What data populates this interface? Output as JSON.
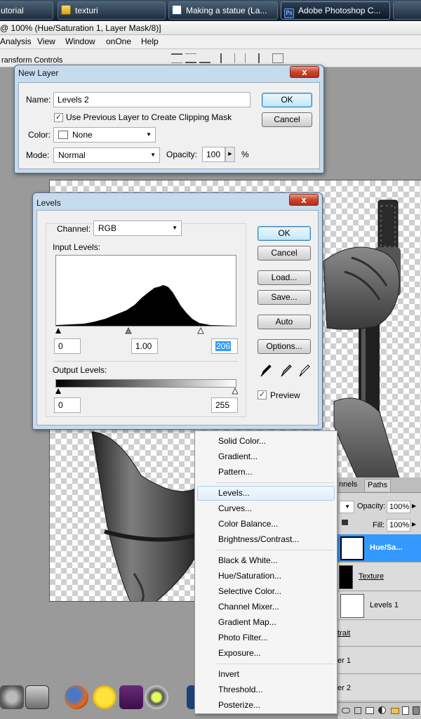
{
  "taskbar": {
    "tasks": [
      {
        "label": "utorial"
      },
      {
        "label": "texturi"
      },
      {
        "label": "Making a statue (La..."
      },
      {
        "label": "Adobe Photoshop C..."
      }
    ]
  },
  "photoshop": {
    "title": "@ 100% (Hue/Saturation 1, Layer Mask/8)]",
    "menu": [
      "Analysis",
      "View",
      "Window",
      "onOne",
      "Help"
    ],
    "options_label": "ransform Controls"
  },
  "new_layer_dialog": {
    "title": "New Layer",
    "close": "x",
    "name_label": "Name:",
    "name_value": "Levels 2",
    "clip_label": "Use Previous Layer to Create Clipping Mask",
    "clip_checked": true,
    "color_label": "Color:",
    "color_value": "None",
    "mode_label": "Mode:",
    "mode_value": "Normal",
    "opacity_label": "Opacity:",
    "opacity_value": "100",
    "percent": "%",
    "ok": "OK",
    "cancel": "Cancel"
  },
  "levels_dialog": {
    "title": "Levels",
    "close": "x",
    "channel_label": "Channel:",
    "channel_value": "RGB",
    "input_label": "Input Levels:",
    "input_black": "0",
    "input_gamma": "1.00",
    "input_white": "206",
    "output_label": "Output Levels:",
    "output_black": "0",
    "output_white": "255",
    "ok": "OK",
    "cancel": "Cancel",
    "load": "Load...",
    "save": "Save...",
    "auto": "Auto",
    "options": "Options...",
    "preview_label": "Preview",
    "preview_checked": true
  },
  "context_menu": {
    "groups": [
      [
        "Solid Color...",
        "Gradient...",
        "Pattern..."
      ],
      [
        "Levels...",
        "Curves...",
        "Color Balance...",
        "Brightness/Contrast..."
      ],
      [
        "Black & White...",
        "Hue/Saturation...",
        "Selective Color...",
        "Channel Mixer...",
        "Gradient Map...",
        "Photo Filter...",
        "Exposure..."
      ],
      [
        "Invert",
        "Threshold...",
        "Posterize..."
      ]
    ],
    "highlighted": "Levels..."
  },
  "layers_panel": {
    "tabs": [
      "nnels",
      "Paths"
    ],
    "opacity_label": "Opacity:",
    "opacity_value": "100%",
    "fill_label": "Fill:",
    "fill_value": "100%",
    "layers": [
      "Hue/Sa...",
      "Texture",
      "Levels 1",
      "trait",
      "er 1",
      "er 2"
    ],
    "selected": "Hue/Sa..."
  },
  "colors": {
    "title_active": "#c6dbee",
    "selection": "#3399ff",
    "menu_highlight": "#e2eefb"
  }
}
